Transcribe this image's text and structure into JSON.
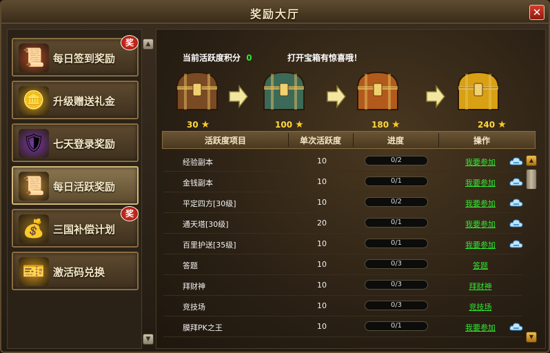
{
  "window": {
    "title": "奖励大厅",
    "close_label": "✕"
  },
  "nav": {
    "items": [
      {
        "label": "每日签到奖励",
        "badge": "奖",
        "icon": "scroll-icon"
      },
      {
        "label": "升级赠送礼金",
        "badge": "",
        "icon": "gold-ingot-icon"
      },
      {
        "label": "七天登录奖励",
        "badge": "",
        "icon": "shield-sword-icon"
      },
      {
        "label": "每日活跃奖励",
        "badge": "",
        "icon": "scroll-check-icon",
        "active": true
      },
      {
        "label": "三国补偿计划",
        "badge": "奖",
        "icon": "money-bag-icon"
      },
      {
        "label": "激活码兑换",
        "badge": "",
        "icon": "gift-card-icon"
      }
    ]
  },
  "main": {
    "score_label": "当前活跃度积分",
    "score_value": "0",
    "hint": "打开宝箱有惊喜哦！",
    "chests": [
      {
        "points": "30",
        "color": "#7a4a24"
      },
      {
        "points": "100",
        "color": "#3c6a58"
      },
      {
        "points": "180",
        "color": "#b25a1c"
      },
      {
        "points": "240",
        "color": "#d8a012"
      }
    ],
    "table": {
      "headers": [
        "活跃度项目",
        "单次活跃度",
        "进度",
        "操作"
      ],
      "rows": [
        {
          "name": "经验副本",
          "per": "10",
          "progress": "0/2",
          "fill": 0,
          "action": "我要参加",
          "cloud": true
        },
        {
          "name": "金钱副本",
          "per": "10",
          "progress": "0/1",
          "fill": 0,
          "action": "我要参加",
          "cloud": true
        },
        {
          "name": "平定四方[30级]",
          "per": "10",
          "progress": "0/2",
          "fill": 0,
          "action": "我要参加",
          "cloud": true
        },
        {
          "name": "通天塔[30级]",
          "per": "20",
          "progress": "0/1",
          "fill": 0,
          "action": "我要参加",
          "cloud": true
        },
        {
          "name": "百里护送[35级]",
          "per": "10",
          "progress": "0/1",
          "fill": 0,
          "action": "我要参加",
          "cloud": true
        },
        {
          "name": "答题",
          "per": "10",
          "progress": "0/3",
          "fill": 0,
          "action": "答题",
          "cloud": false
        },
        {
          "name": "拜财神",
          "per": "10",
          "progress": "0/3",
          "fill": 0,
          "action": "拜财神",
          "cloud": false
        },
        {
          "name": "竞技场",
          "per": "10",
          "progress": "0/3",
          "fill": 0,
          "action": "竞技场",
          "cloud": false
        },
        {
          "name": "膜拜PK之王",
          "per": "10",
          "progress": "0/1",
          "fill": 0,
          "action": "我要参加",
          "cloud": true
        }
      ]
    }
  }
}
